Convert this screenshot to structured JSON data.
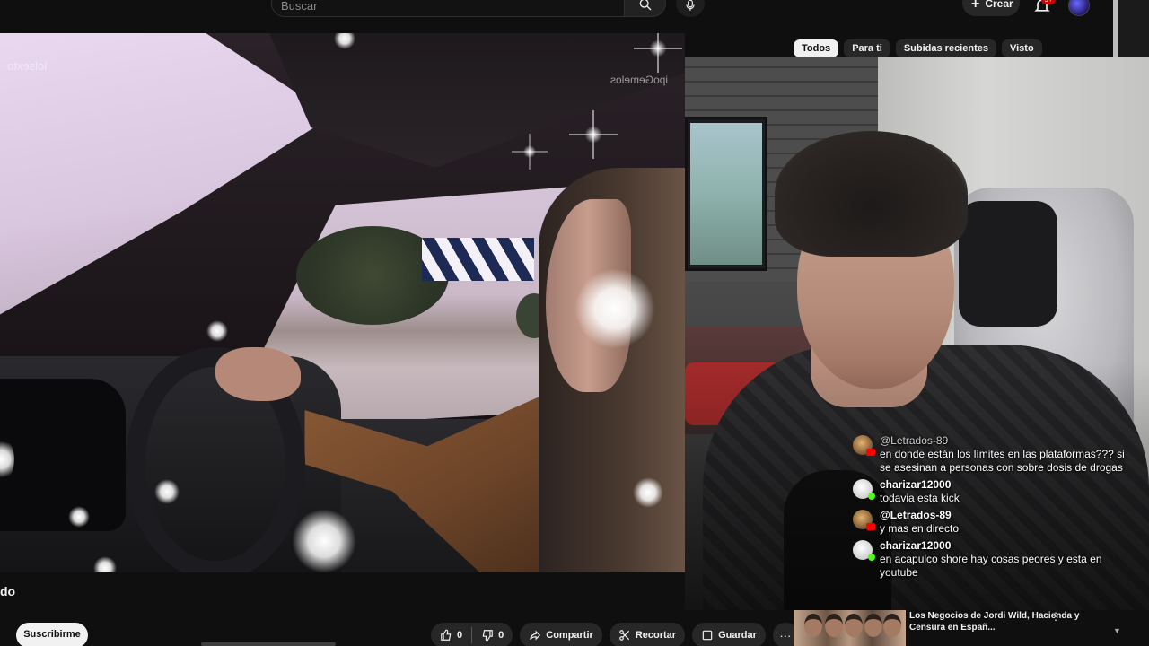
{
  "search": {
    "placeholder": "Buscar"
  },
  "header": {
    "create_label": "Crear",
    "notifications_count": "9+"
  },
  "filter_chips": [
    {
      "label": "Todos",
      "active": true
    },
    {
      "label": "Para ti",
      "active": false
    },
    {
      "label": "Subidas recientes",
      "active": false
    },
    {
      "label": "Visto",
      "active": false
    }
  ],
  "player": {
    "watermark": "ipoGemelos",
    "watermark_left": "lolsexto"
  },
  "video": {
    "title_fragment": "do",
    "subscribe_label": "Suscribirme",
    "like_count": "0",
    "dislike_count": "0",
    "share_label": "Compartir",
    "clip_label": "Recortar",
    "save_label": "Guardar",
    "more_label": "···"
  },
  "chat": [
    {
      "user": "@Letrados-89",
      "text": "en donde están los límites en las plataformas??? si se asesinan a personas con sobre dosis de drogas",
      "platform": "youtube",
      "dim": true
    },
    {
      "user": "charizar12000",
      "text": "todavia esta kick",
      "platform": "kick",
      "dim": false
    },
    {
      "user": "@Letrados-89",
      "text": "y mas en directo",
      "platform": "youtube",
      "dim": false
    },
    {
      "user": "charizar12000",
      "text": "en acapulco shore hay cosas peores y esta en youtube",
      "platform": "kick",
      "dim": false
    }
  ],
  "recommended": {
    "title": "Los Negocios de Jordi Wild, Hacienda y Censura en Españ..."
  },
  "colors": {
    "accent_red": "#ff0000",
    "kick_green": "#53fc18",
    "background": "#0f0f0f",
    "chip_bg": "#272727"
  }
}
